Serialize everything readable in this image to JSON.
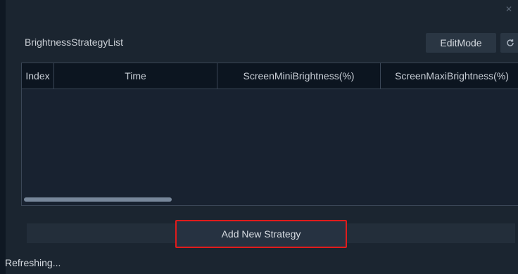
{
  "window": {
    "title": "BrightnessStrategyList",
    "close_icon": "close-icon"
  },
  "toolbar": {
    "edit_mode_label": "EditMode",
    "refresh_icon": "refresh-icon"
  },
  "table": {
    "columns": [
      "Index",
      "Time",
      "ScreenMiniBrightness(%)",
      "ScreenMaxiBrightness(%)"
    ],
    "rows": []
  },
  "actions": {
    "add_strategy_label": "Add New Strategy"
  },
  "status": {
    "text": "Refreshing..."
  },
  "colors": {
    "highlight": "#e11b1b",
    "background": "#1b2530"
  }
}
